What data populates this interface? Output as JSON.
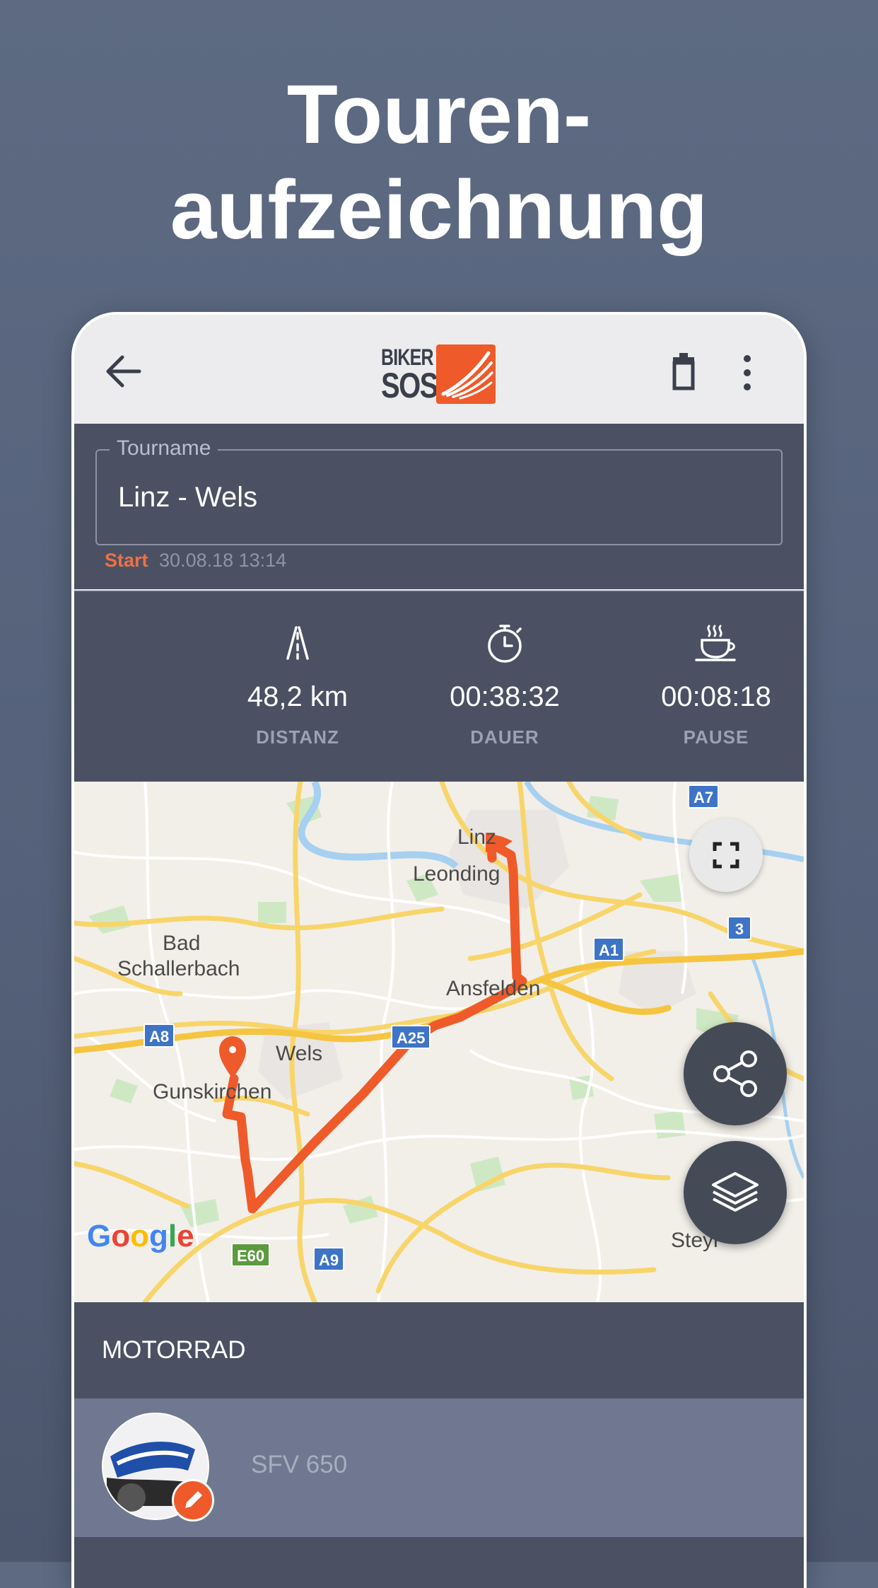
{
  "headline": {
    "line1": "Touren-",
    "line2": "aufzeichnung"
  },
  "toolbar": {
    "back_icon": "arrow-left-icon",
    "logo": {
      "line1": "BIKER",
      "line2": "SOS"
    },
    "delete_icon": "trash-icon",
    "more_icon": "more-vertical-icon"
  },
  "tour": {
    "field_label": "Tourname",
    "name": "Linz - Wels",
    "start_label": "Start",
    "start_value": "30.08.18 13:14"
  },
  "stats": [
    {
      "icon": "road-icon",
      "value": "48,2 km",
      "label": "DISTANZ"
    },
    {
      "icon": "stopwatch-icon",
      "value": "00:38:32",
      "label": "DAUER"
    },
    {
      "icon": "coffee-cup-icon",
      "value": "00:08:18",
      "label": "PAUSE"
    }
  ],
  "map": {
    "places": {
      "linz": "Linz",
      "leonding": "Leonding",
      "bad": "Bad",
      "schallerbach": "Schallerbach",
      "ansfelden": "Ansfelden",
      "wels": "Wels",
      "gunskirchen": "Gunskirchen",
      "steyr": "Steyr"
    },
    "shields": {
      "a7": "A7",
      "a1": "A1",
      "r3": "3",
      "a8": "A8",
      "a25": "A25",
      "e60": "E60",
      "a9": "A9"
    },
    "attribution": "Google",
    "route_color": "#ef5a2b",
    "buttons": {
      "fullscreen_icon": "fullscreen-icon",
      "share_icon": "share-icon",
      "layers_icon": "layers-icon"
    }
  },
  "motorrad": {
    "title": "MOTORRAD",
    "bike_name": "SFV 650",
    "edit_icon": "pencil-icon"
  },
  "colors": {
    "accent": "#ef5a2b",
    "panel": "#4b5163",
    "background": "#58647c"
  }
}
